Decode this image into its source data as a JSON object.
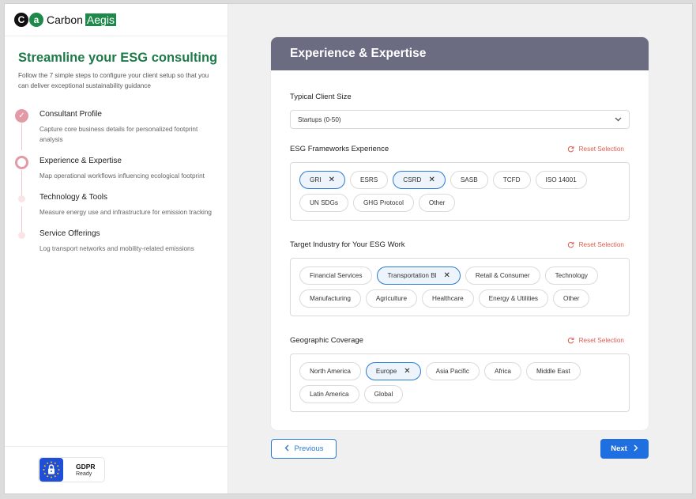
{
  "brand": {
    "mark1": "C",
    "mark2": "a",
    "name1": "Carbon",
    "name2": "Aegis"
  },
  "sidebar": {
    "title": "Streamline your ESG consulting",
    "description": "Follow the 7 simple steps to configure your client setup so that you can deliver exceptional sustainability guidance",
    "steps": [
      {
        "title": "Consultant Profile",
        "desc": "Capture core business details for personalized footprint analysis",
        "state": "done"
      },
      {
        "title": "Experience & Expertise",
        "desc": "Map operational workflows influencing ecological footprint",
        "state": "current"
      },
      {
        "title": "Technology & Tools",
        "desc": "Measure energy use and infrastructure for emission tracking",
        "state": "upcoming"
      },
      {
        "title": "Service Offerings",
        "desc": "Log transport networks and mobility-related emissions",
        "state": "upcoming"
      }
    ],
    "gdpr": {
      "title": "GDPR",
      "subtitle": "Ready"
    }
  },
  "card": {
    "title": "Experience & Expertise",
    "client_size": {
      "label": "Typical Client Size",
      "value": "Startups (0-50)"
    },
    "reset_label": "Reset Selection",
    "frameworks": {
      "label": "ESG Frameworks Experience",
      "options": [
        {
          "label": "GRI",
          "selected": true
        },
        {
          "label": "ESRS",
          "selected": false
        },
        {
          "label": "CSRD",
          "selected": true
        },
        {
          "label": "SASB",
          "selected": false
        },
        {
          "label": "TCFD",
          "selected": false
        },
        {
          "label": "ISO 14001",
          "selected": false
        },
        {
          "label": "UN SDGs",
          "selected": false
        },
        {
          "label": "GHG Protocol",
          "selected": false
        },
        {
          "label": "Other",
          "selected": false
        }
      ]
    },
    "industry": {
      "label": "Target Industry for Your ESG Work",
      "options": [
        {
          "label": "Financial Services",
          "selected": false
        },
        {
          "label": "Transportation Bl",
          "selected": true
        },
        {
          "label": "Retail & Consumer",
          "selected": false
        },
        {
          "label": "Technology",
          "selected": false
        },
        {
          "label": "Manufacturing",
          "selected": false
        },
        {
          "label": "Agriculture",
          "selected": false
        },
        {
          "label": "Healthcare",
          "selected": false
        },
        {
          "label": "Energy & Utilities",
          "selected": false
        },
        {
          "label": "Other",
          "selected": false
        }
      ]
    },
    "geography": {
      "label": "Geographic Coverage",
      "options": [
        {
          "label": "North America",
          "selected": false
        },
        {
          "label": "Europe",
          "selected": true
        },
        {
          "label": "Asia Pacific",
          "selected": false
        },
        {
          "label": "Africa",
          "selected": false
        },
        {
          "label": "Middle East",
          "selected": false
        },
        {
          "label": "Latin America",
          "selected": false
        },
        {
          "label": "Global",
          "selected": false
        }
      ]
    }
  },
  "nav": {
    "previous_label": "Previous",
    "next_label": "Next"
  },
  "colors": {
    "brand_green": "#1e8a4a",
    "accent_blue": "#1f6fe0",
    "header_gray": "#6b6b82",
    "step_pink": "#e39aa7",
    "reset_red": "#e05a4c"
  }
}
